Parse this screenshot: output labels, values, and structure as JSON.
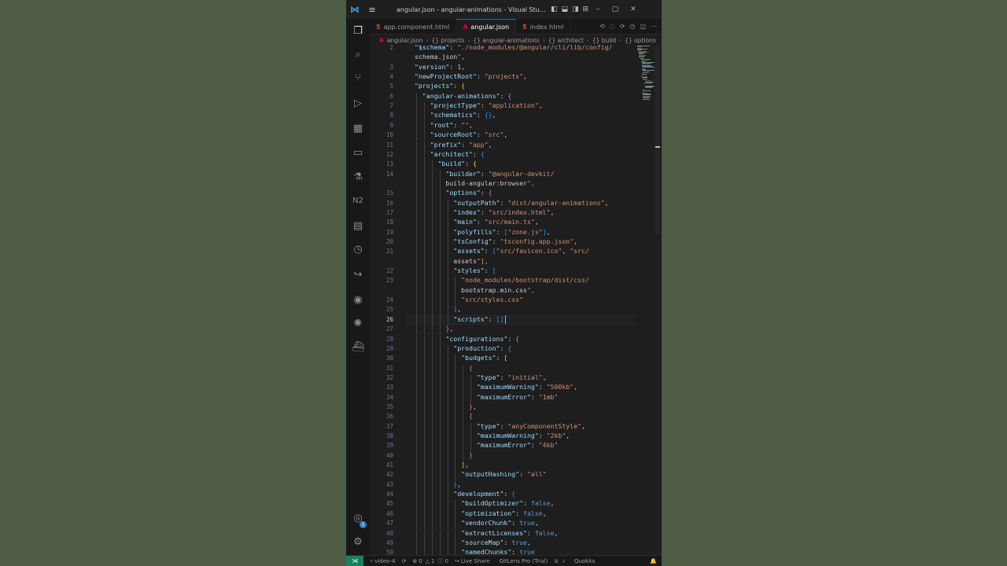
{
  "window": {
    "title": "angular.json - angular-animations - Visual Studio Co...",
    "menu_icon": "hamburger-icon",
    "logo_icon": "vscode-logo-icon"
  },
  "tabs": [
    {
      "label": "app.component.html",
      "icon": "html-file-icon",
      "active": false
    },
    {
      "label": "angular.json",
      "icon": "angular-icon",
      "active": true
    },
    {
      "label": "index.html",
      "icon": "html-file-icon",
      "active": false
    }
  ],
  "breadcrumb": [
    "angular.json",
    "{} projects",
    "{} angular-animations",
    "{} architect",
    "{} build",
    "{} options"
  ],
  "gutter": {
    "current_line": "26",
    "line_numbers": [
      "2",
      "",
      "3",
      "4",
      "5",
      "6",
      "7",
      "8",
      "9",
      "10",
      "11",
      "12",
      "13",
      "14",
      "",
      "15",
      "16",
      "17",
      "18",
      "19",
      "20",
      "21",
      "",
      "22",
      "23",
      "",
      "24",
      "25",
      "26",
      "27",
      "28",
      "29",
      "30",
      "31",
      "32",
      "33",
      "34",
      "35",
      "36",
      "37",
      "38",
      "39",
      "40",
      "41",
      "42",
      "43",
      "44",
      "45",
      "46",
      "47",
      "48",
      "49",
      "50"
    ]
  },
  "code_lines": [
    "\"$schema\": \"./node_modules/@angular/cli/lib/config/",
    "schema.json\",",
    "\"version\": 1,",
    "\"newProjectRoot\": \"projects\",",
    "\"projects\": {",
    "  \"angular-animations\": {",
    "    \"projectType\": \"application\",",
    "    \"schematics\": {},",
    "    \"root\": \"\",",
    "    \"sourceRoot\": \"src\",",
    "    \"prefix\": \"app\",",
    "    \"architect\": {",
    "      \"build\": {",
    "        \"builder\": \"@angular-devkit/",
    "        build-angular:browser\",",
    "        \"options\": {",
    "          \"outputPath\": \"dist/angular-animations\",",
    "          \"index\": \"src/index.html\",",
    "          \"main\": \"src/main.ts\",",
    "          \"polyfills\": [\"zone.js\"],",
    "          \"tsConfig\": \"tsconfig.app.json\",",
    "          \"assets\": [\"src/favicon.ico\", \"src/",
    "          assets\"],",
    "          \"styles\": [",
    "            \"node_modules/bootstrap/dist/css/",
    "            bootstrap.min.css\",",
    "            \"src/styles.css\"",
    "          ],",
    "          \"scripts\": []",
    "        },",
    "        \"configurations\": {",
    "          \"production\": {",
    "            \"budgets\": [",
    "              {",
    "                \"type\": \"initial\",",
    "                \"maximumWarning\": \"500kb\",",
    "                \"maximumError\": \"1mb\"",
    "              },",
    "              {",
    "                \"type\": \"anyComponentStyle\",",
    "                \"maximumWarning\": \"2kb\",",
    "                \"maximumError\": \"4kb\"",
    "              }",
    "            ],",
    "            \"outputHashing\": \"all\"",
    "          },",
    "          \"development\": {",
    "            \"buildOptimizer\": false,",
    "            \"optimization\": false,",
    "            \"vendorChunk\": true,",
    "            \"extractLicenses\": false,",
    "            \"sourceMap\": true,",
    "            \"namedChunks\": true"
  ],
  "activity_bar": [
    {
      "name": "explorer-icon",
      "glyph": "❐"
    },
    {
      "name": "search-icon",
      "glyph": "⌕"
    },
    {
      "name": "source-control-icon",
      "glyph": "⑂"
    },
    {
      "name": "run-debug-icon",
      "glyph": "▷"
    },
    {
      "name": "extensions-icon",
      "glyph": "▦"
    },
    {
      "name": "remote-explorer-icon",
      "glyph": "▭"
    },
    {
      "name": "testing-icon",
      "glyph": "⚗"
    },
    {
      "name": "nx-console-icon",
      "glyph": "N2"
    },
    {
      "name": "clipboard-icon",
      "glyph": "▤"
    },
    {
      "name": "timeline-icon",
      "glyph": "◷"
    },
    {
      "name": "live-share-icon",
      "glyph": "↪"
    },
    {
      "name": "github-icon",
      "glyph": "◉"
    },
    {
      "name": "gitlens-icon",
      "glyph": "✺"
    },
    {
      "name": "docker-icon",
      "glyph": "⛴"
    }
  ],
  "accounts_badge": "1",
  "status_bar": {
    "remote_icon": "remote-icon",
    "branch": "video-4",
    "errors": "0",
    "warnings": "1",
    "info": "0",
    "live_share": "Live Share",
    "gitlens": "GitLens Pro (Trial)",
    "quokka": "Quokka"
  },
  "colors": {
    "background": "#4f5c44",
    "editor_bg": "#1e1e1e",
    "accent": "#0078d4"
  }
}
